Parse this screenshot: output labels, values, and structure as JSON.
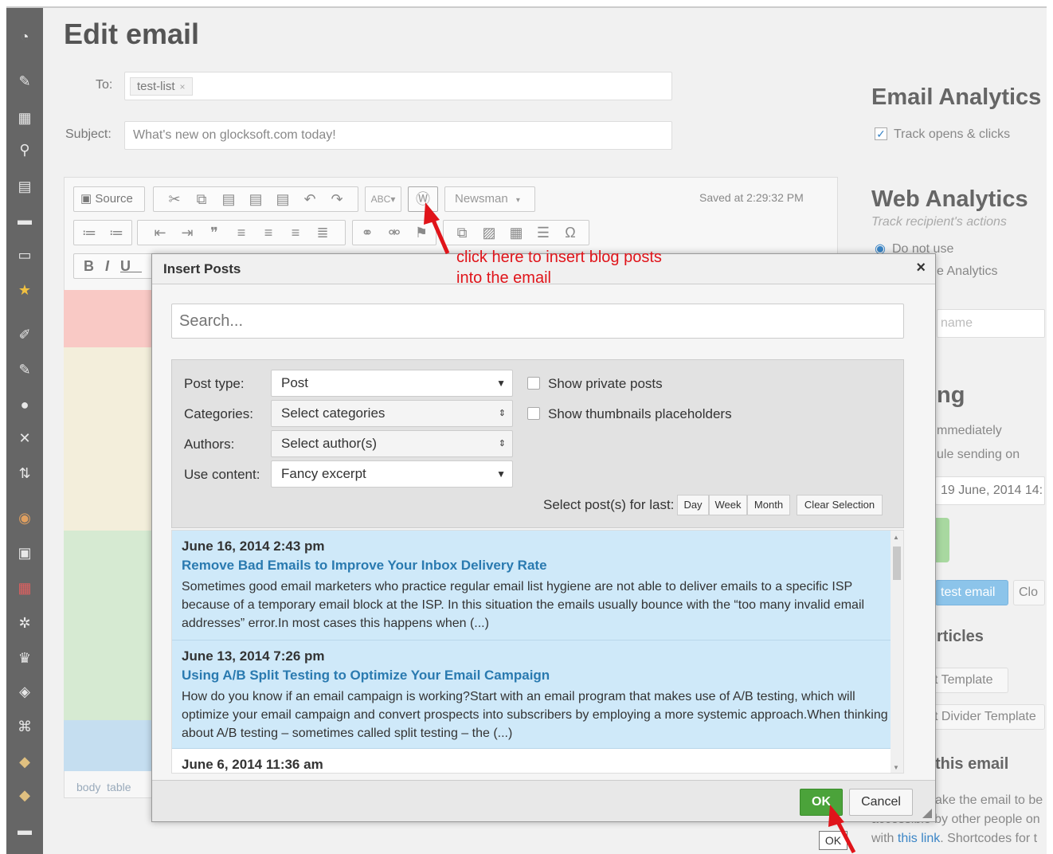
{
  "page": {
    "title": "Edit email"
  },
  "form": {
    "to_label": "To:",
    "to_tag": "test-list",
    "subject_label": "Subject:",
    "subject_value": "What's new on glocksoft.com today!"
  },
  "editor": {
    "source_label": "Source",
    "format_label": "Newsman",
    "saved": "Saved at 2:29:32 PM",
    "path": [
      "body",
      "table"
    ]
  },
  "annotation": {
    "line1": "click here to insert blog posts",
    "line2": "into the email"
  },
  "right": {
    "analytics_title": "Email Analytics",
    "track_label": "Track opens & clicks",
    "web_title": "Web Analytics",
    "web_sub": "Track recipient's actions",
    "do_not_use": "Do not use",
    "analytics_frag": "e Analytics",
    "name_frag": "name",
    "ng_frag": "ng",
    "immediately_frag": "mmediately",
    "schedule_frag": "ule sending on",
    "date_frag": "19 June, 2014 14:",
    "test_email": "test email",
    "clo_frag": "Clo",
    "articles_frag": "rticles",
    "template_frag": "t Template",
    "divider_frag": "t Divider Template",
    "this_email_frag": "this email",
    "make_frag": "ake the email to be",
    "access_frag": "accessible by other people on",
    "with_frag": "with",
    "this_link": "this link",
    "shortcodes_frag": ". Shortcodes for t"
  },
  "modal": {
    "title": "Insert Posts",
    "close": "×",
    "search_placeholder": "Search...",
    "filters": {
      "post_type_label": "Post type:",
      "post_type_value": "Post",
      "categories_label": "Categories:",
      "categories_value": "Select categories",
      "authors_label": "Authors:",
      "authors_value": "Select author(s)",
      "content_label": "Use content:",
      "content_value": "Fancy excerpt",
      "show_private": "Show private posts",
      "show_thumbs": "Show thumbnails placeholders",
      "select_for_last": "Select post(s) for last:",
      "day": "Day",
      "week": "Week",
      "month": "Month",
      "clear": "Clear Selection"
    },
    "posts": [
      {
        "date": "June 16, 2014 2:43 pm",
        "title": "Remove Bad Emails to Improve Your Inbox Delivery Rate",
        "excerpt": "Sometimes good email marketers who practice regular email list hygiene are not able to deliver emails to a specific ISP because of a temporary email block at the ISP. In this situation the emails usually bounce with the “too many invalid email addresses” error.In most cases this happens when (...)"
      },
      {
        "date": "June 13, 2014 7:26 pm",
        "title": "Using A/B Split Testing to Optimize Your Email Campaign",
        "excerpt": "How do you know if an email campaign is working?Start with an email program that makes use of A/B testing, which will optimize your email campaign and convert prospects into subscribers by employing a more systemic approach.When thinking about A/B testing – sometimes called split testing – the (...)"
      },
      {
        "date": "June 6, 2014 11:36 am",
        "title": "",
        "excerpt": ""
      }
    ],
    "ok": "OK",
    "cancel": "Cancel",
    "tooltip": "OK"
  },
  "colors": {
    "accent_green": "#4ba33a",
    "link_blue": "#2a7ab0",
    "annotation_red": "#e0141a",
    "post_bg": "#cfe9f9"
  }
}
